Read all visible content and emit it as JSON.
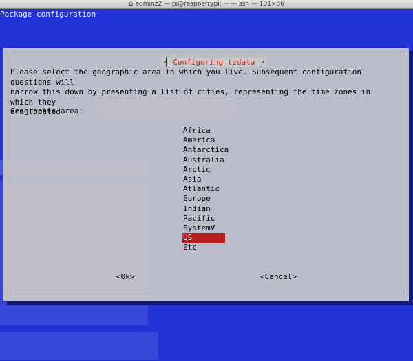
{
  "window": {
    "title": "adminz2 — pi@raspberrypi: ~ — ssh — 101×36"
  },
  "terminal": {
    "header": "Package configuration"
  },
  "dialog": {
    "title": "Configuring tzdata",
    "prompt": "Please select the geographic area in which you live. Subsequent configuration questions will\nnarrow this down by presenting a list of cities, representing the time zones in which they\nare located.",
    "area_label": "Geographic area:",
    "options": [
      "Africa",
      "America",
      "Antarctica",
      "Australia",
      "Arctic",
      "Asia",
      "Atlantic",
      "Europe",
      "Indian",
      "Pacific",
      "SystemV",
      "US",
      "Etc"
    ],
    "selected": "US",
    "ok_label": "<Ok>",
    "cancel_label": "<Cancel>"
  },
  "colors": {
    "terminal_bg": "#2233d6",
    "dialog_bg": "#c9c9c9",
    "title_color": "#c8281f",
    "selection_bg": "#b81f1f"
  },
  "icons": {
    "home": "home-icon"
  }
}
